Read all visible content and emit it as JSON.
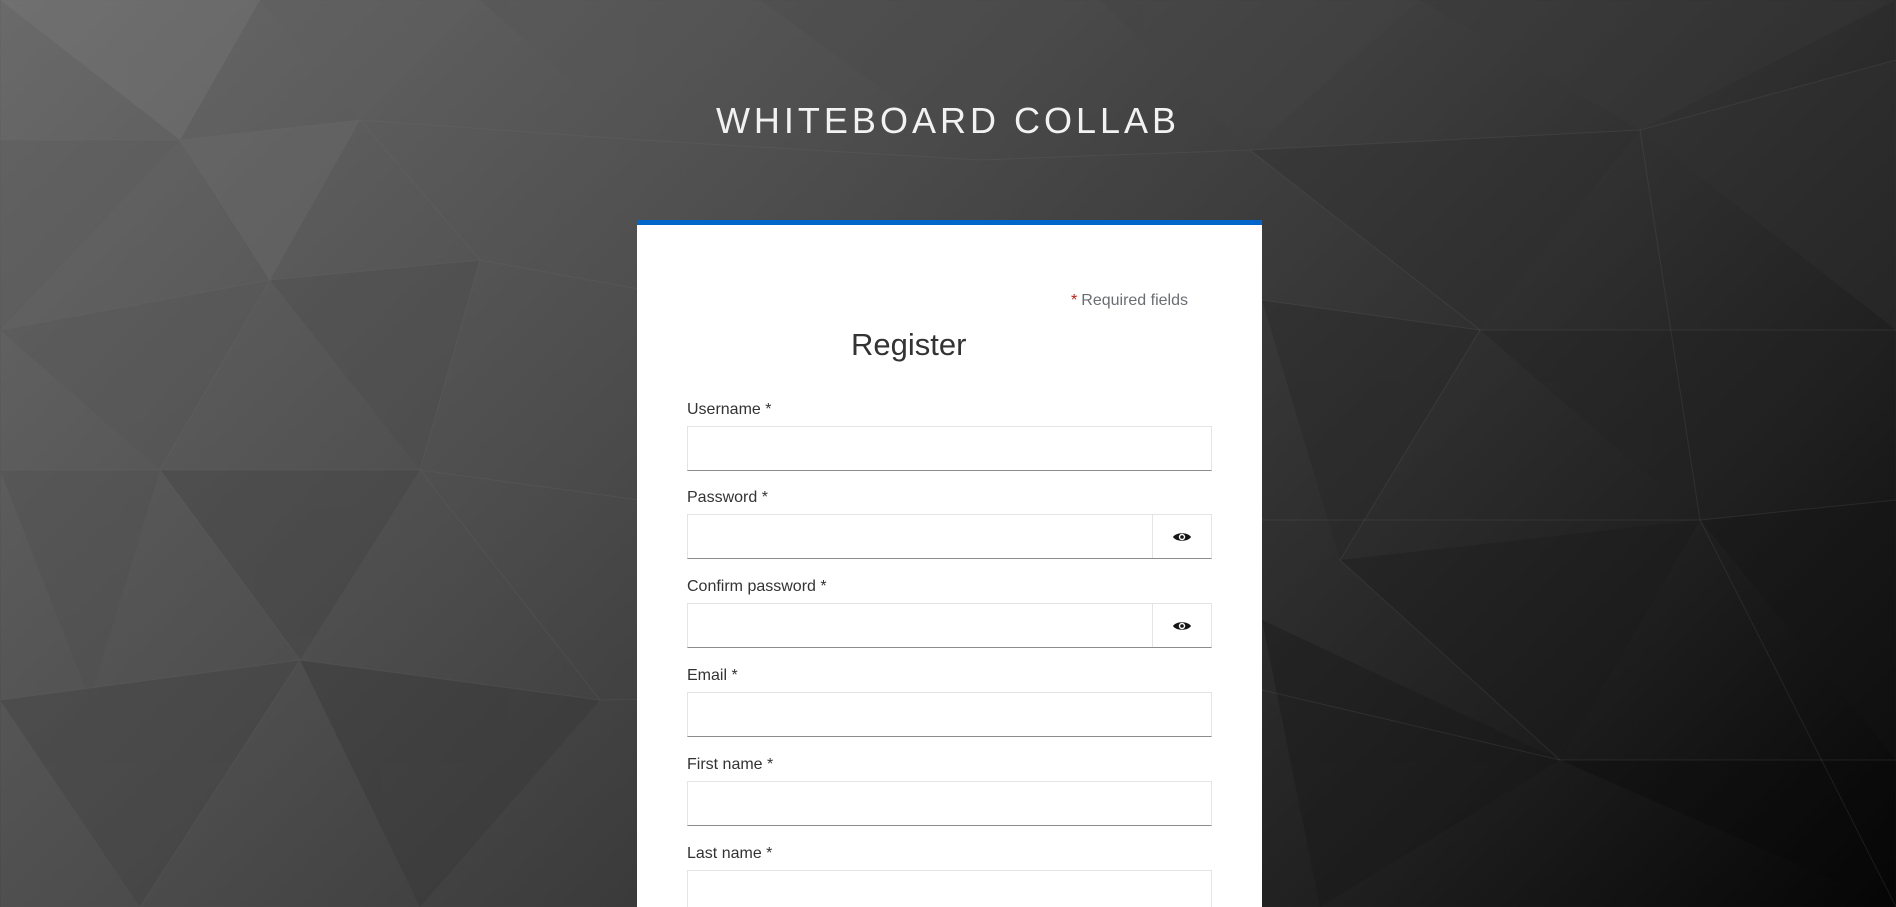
{
  "app": {
    "title": "WHITEBOARD COLLAB"
  },
  "form": {
    "required_note": "Required fields",
    "required_star": "*",
    "title": "Register",
    "fields": [
      {
        "label": "Username *",
        "value": ""
      },
      {
        "label": "Password *",
        "value": "",
        "toggle_icon": "eye-icon"
      },
      {
        "label": "Confirm password *",
        "value": "",
        "toggle_icon": "eye-icon"
      },
      {
        "label": "Email *",
        "value": ""
      },
      {
        "label": "First name *",
        "value": ""
      },
      {
        "label": "Last name *",
        "value": ""
      }
    ]
  },
  "colors": {
    "accent": "#0066cc",
    "required": "#c9190b"
  }
}
